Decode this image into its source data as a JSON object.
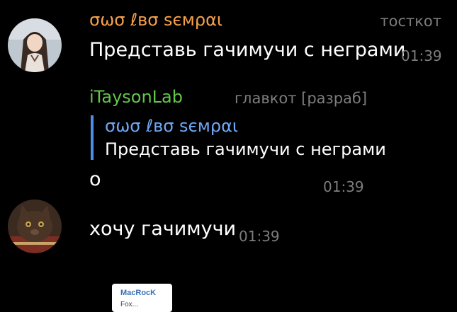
{
  "messages": [
    {
      "sender": "σωσ ℓвσ ѕємραι",
      "sender_badge": "тосткот",
      "text": "Представь гачимучи с неграми",
      "time": "01:39"
    },
    {
      "sender": "iTaysonLab",
      "sender_badge": "главкот [разраб]",
      "reply": {
        "sender": "σωσ ℓвσ ѕємραι",
        "text": "Представь гачимучи с неграми"
      },
      "text": "о",
      "time": "01:39"
    },
    {
      "text": "хочу гачимучи",
      "time": "01:39"
    }
  ],
  "sticker": {
    "title": "MacRocK",
    "subtitle": "Fox..."
  },
  "colors": {
    "background": "#000000",
    "sender_orange": "#f5a04b",
    "sender_green": "#62c64b",
    "reply_accent": "#4f8ee8",
    "muted": "#7d7d7d"
  },
  "icons": [
    "avatar-anime-girl",
    "avatar-cat"
  ]
}
